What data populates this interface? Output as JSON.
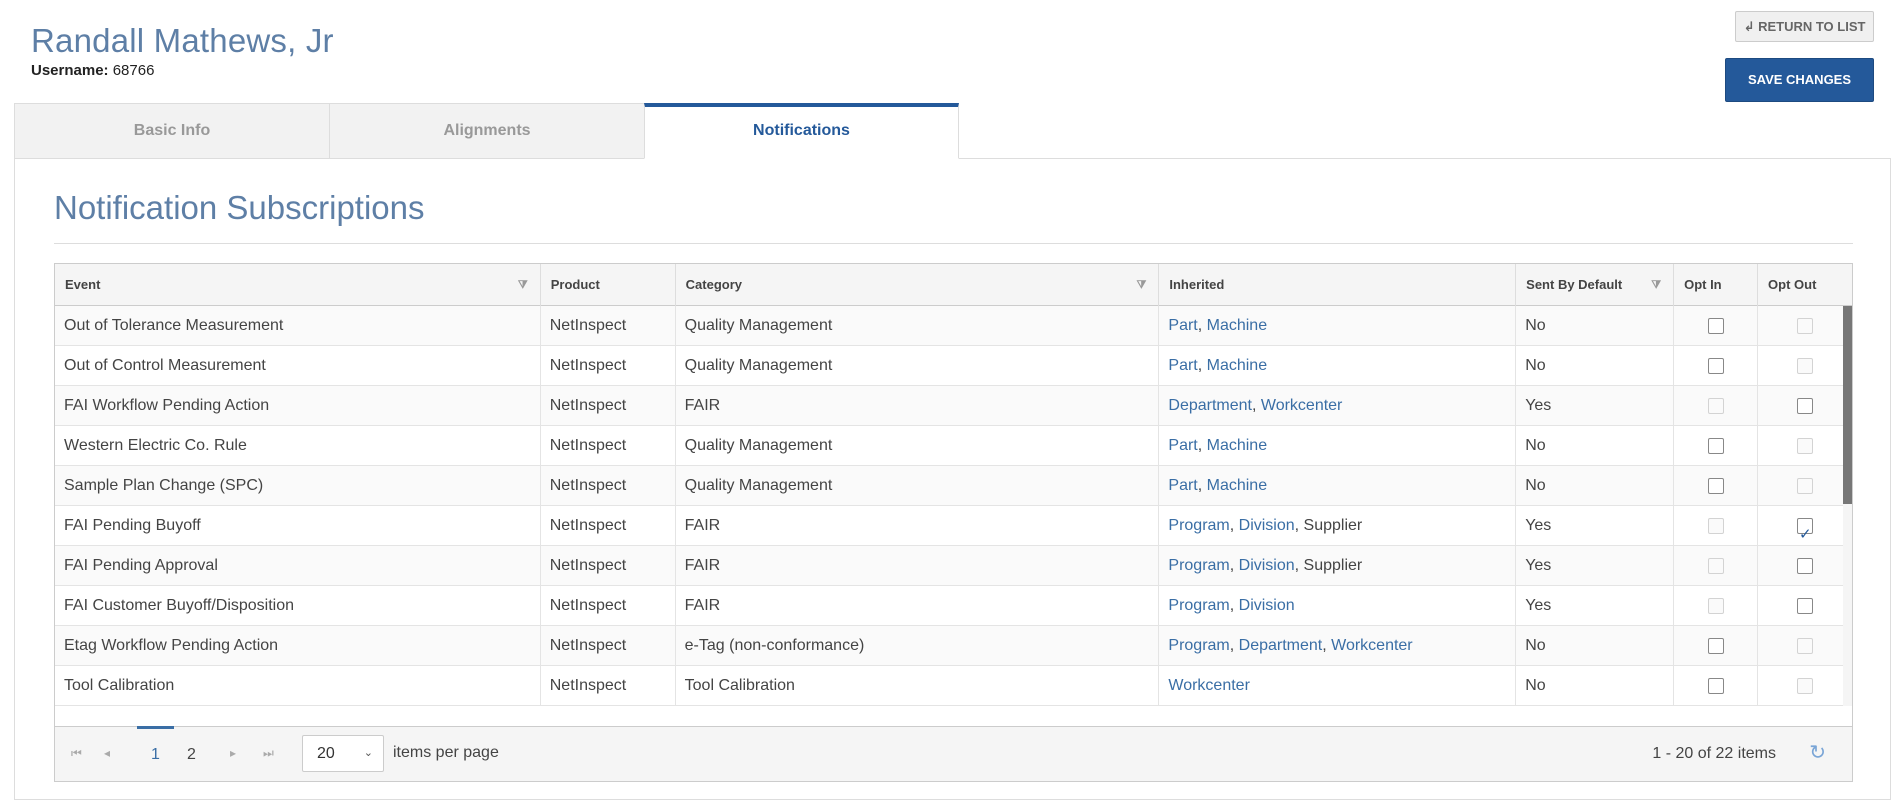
{
  "header": {
    "name": "Randall Mathews, Jr",
    "username_label": "Username:",
    "username_value": "68766"
  },
  "actions": {
    "return_label": "↲ RETURN TO LIST",
    "save_label": "SAVE CHANGES"
  },
  "tabs": [
    {
      "label": "Basic Info",
      "active": false
    },
    {
      "label": "Alignments",
      "active": false
    },
    {
      "label": "Notifications",
      "active": true
    }
  ],
  "section_title": "Notification Subscriptions",
  "columns": [
    {
      "label": "Event",
      "filter": true
    },
    {
      "label": "Product",
      "filter": false
    },
    {
      "label": "Category",
      "filter": true
    },
    {
      "label": "Inherited",
      "filter": false
    },
    {
      "label": "Sent By Default",
      "filter": true
    },
    {
      "label": "Opt In",
      "filter": false
    },
    {
      "label": "Opt Out",
      "filter": false
    }
  ],
  "rows": [
    {
      "event": "Out of Tolerance Measurement",
      "product": "NetInspect",
      "category": "Quality Management",
      "inherited": [
        {
          "text": "Part",
          "link": true
        },
        {
          "text": "Machine",
          "link": true
        }
      ],
      "default": "No",
      "opt_in": {
        "checked": false,
        "enabled": true
      },
      "opt_out": {
        "checked": false,
        "enabled": false
      }
    },
    {
      "event": "Out of Control Measurement",
      "product": "NetInspect",
      "category": "Quality Management",
      "inherited": [
        {
          "text": "Part",
          "link": true
        },
        {
          "text": "Machine",
          "link": true
        }
      ],
      "default": "No",
      "opt_in": {
        "checked": false,
        "enabled": true
      },
      "opt_out": {
        "checked": false,
        "enabled": false
      }
    },
    {
      "event": "FAI Workflow Pending Action",
      "product": "NetInspect",
      "category": "FAIR",
      "inherited": [
        {
          "text": "Department",
          "link": true
        },
        {
          "text": "Workcenter",
          "link": true
        }
      ],
      "default": "Yes",
      "opt_in": {
        "checked": false,
        "enabled": false
      },
      "opt_out": {
        "checked": false,
        "enabled": true
      }
    },
    {
      "event": "Western Electric Co. Rule",
      "product": "NetInspect",
      "category": "Quality Management",
      "inherited": [
        {
          "text": "Part",
          "link": true
        },
        {
          "text": "Machine",
          "link": true
        }
      ],
      "default": "No",
      "opt_in": {
        "checked": false,
        "enabled": true
      },
      "opt_out": {
        "checked": false,
        "enabled": false
      }
    },
    {
      "event": "Sample Plan Change (SPC)",
      "product": "NetInspect",
      "category": "Quality Management",
      "inherited": [
        {
          "text": "Part",
          "link": true
        },
        {
          "text": "Machine",
          "link": true
        }
      ],
      "default": "No",
      "opt_in": {
        "checked": false,
        "enabled": true
      },
      "opt_out": {
        "checked": false,
        "enabled": false
      }
    },
    {
      "event": "FAI Pending Buyoff",
      "product": "NetInspect",
      "category": "FAIR",
      "inherited": [
        {
          "text": "Program",
          "link": true
        },
        {
          "text": "Division",
          "link": true
        },
        {
          "text": "Supplier",
          "link": false
        }
      ],
      "default": "Yes",
      "opt_in": {
        "checked": false,
        "enabled": false
      },
      "opt_out": {
        "checked": true,
        "enabled": true
      }
    },
    {
      "event": "FAI Pending Approval",
      "product": "NetInspect",
      "category": "FAIR",
      "inherited": [
        {
          "text": "Program",
          "link": true
        },
        {
          "text": "Division",
          "link": true
        },
        {
          "text": "Supplier",
          "link": false
        }
      ],
      "default": "Yes",
      "opt_in": {
        "checked": false,
        "enabled": false
      },
      "opt_out": {
        "checked": false,
        "enabled": true
      }
    },
    {
      "event": "FAI Customer Buyoff/Disposition",
      "product": "NetInspect",
      "category": "FAIR",
      "inherited": [
        {
          "text": "Program",
          "link": true
        },
        {
          "text": "Division",
          "link": true
        }
      ],
      "default": "Yes",
      "opt_in": {
        "checked": false,
        "enabled": false
      },
      "opt_out": {
        "checked": false,
        "enabled": true
      }
    },
    {
      "event": "Etag Workflow Pending Action",
      "product": "NetInspect",
      "category": "e-Tag (non-conformance)",
      "inherited": [
        {
          "text": "Program",
          "link": true
        },
        {
          "text": "Department",
          "link": true
        },
        {
          "text": "Workcenter",
          "link": true
        }
      ],
      "default": "No",
      "opt_in": {
        "checked": false,
        "enabled": true
      },
      "opt_out": {
        "checked": false,
        "enabled": false
      }
    },
    {
      "event": "Tool Calibration",
      "product": "NetInspect",
      "category": "Tool Calibration",
      "inherited": [
        {
          "text": "Workcenter",
          "link": true
        }
      ],
      "default": "No",
      "opt_in": {
        "checked": false,
        "enabled": true
      },
      "opt_out": {
        "checked": false,
        "enabled": false
      }
    }
  ],
  "pager": {
    "pages": [
      "1",
      "2"
    ],
    "current_page": "1",
    "page_size": "20",
    "items_per_page_label": "items per page",
    "info": "1 - 20 of 22 items"
  },
  "icons": {
    "first": "⏮",
    "prev": "◂",
    "next": "▸",
    "last": "⏭",
    "refresh": "↻",
    "filter": "⧩",
    "chevron": "⌄"
  },
  "colors": {
    "accent": "#24599a",
    "link": "#3a6ea5",
    "title": "#5e7fa6"
  }
}
